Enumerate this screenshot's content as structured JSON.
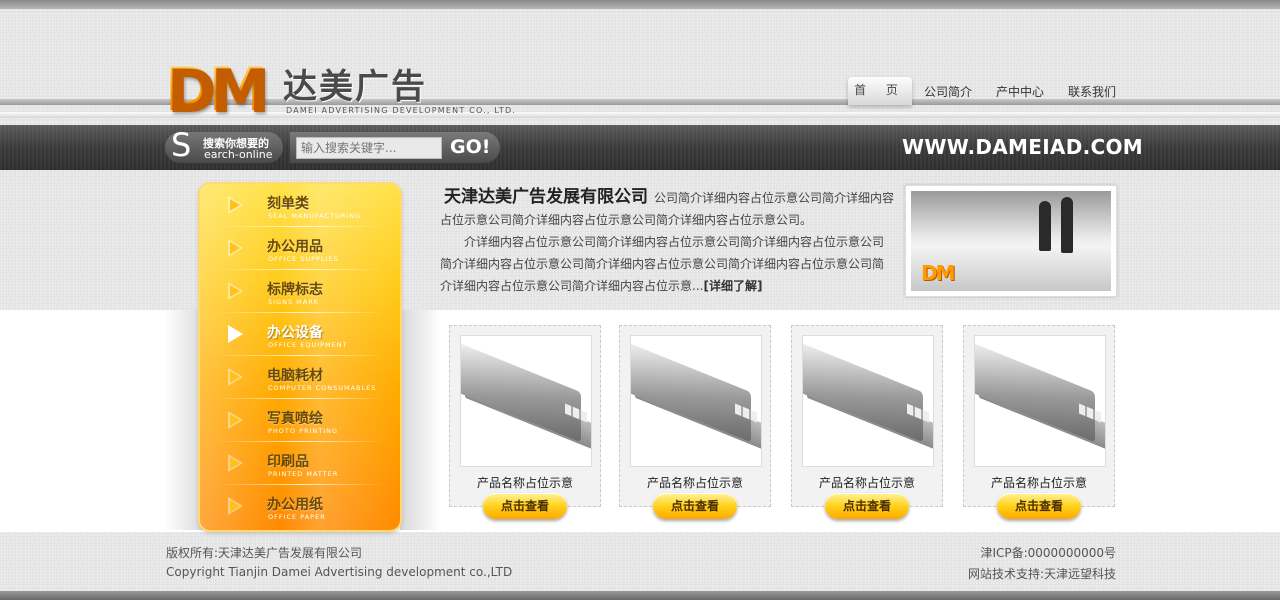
{
  "brand": {
    "logo_letters": "DM",
    "logo_cn": "达美广告",
    "logo_en": "DAMEI ADVERTISING DEVELOPMENT CO., LTD."
  },
  "nav": {
    "items": [
      {
        "label": "首 页"
      },
      {
        "label": "公司简介"
      },
      {
        "label": "产中中心"
      },
      {
        "label": "联系我们"
      }
    ]
  },
  "search": {
    "badge_letter": "S",
    "badge_line1": "搜索你想要的",
    "badge_line2": "earch-online",
    "placeholder": "输入搜索关键字...",
    "button_label": "GO!",
    "site_url": "WWW.DAMEIAD.COM"
  },
  "menu": {
    "items": [
      {
        "cn": "刻单类",
        "en": "SEAL MANUFACTURING"
      },
      {
        "cn": "办公用品",
        "en": "OFFICE SUPPLIES"
      },
      {
        "cn": "标牌标志",
        "en": "SIGNS MARK"
      },
      {
        "cn": "办公设备",
        "en": "OFFICE EQUIPMENT"
      },
      {
        "cn": "电脑耗材",
        "en": "COMPUTER CONSUMABLES"
      },
      {
        "cn": "写真喷绘",
        "en": "PHOTO PRINTING"
      },
      {
        "cn": "印刷品",
        "en": "PRINTED MATTER"
      },
      {
        "cn": "办公用纸",
        "en": "OFFICE PAPER"
      }
    ],
    "active_index": 3
  },
  "intro": {
    "title": "天津达美广告发展有限公司",
    "p1": "公司简介详细内容占位示意公司简介详细内容占位示意公司简介详细内容占位示意公司简介详细内容占位示意公司。",
    "p2": "介详细内容占位示意公司简介详细内容占位示意公司简介详细内容占位示意公司简介详细内容占位示意公司简介详细内容占位示意公司简介详细内容占位示意公司简介详细内容占位示意公司简介详细内容占位示意...",
    "more": "[详细了解]",
    "photo_logo": "DM"
  },
  "products": [
    {
      "name": "产品名称占位示意",
      "button": "点击查看"
    },
    {
      "name": "产品名称占位示意",
      "button": "点击查看"
    },
    {
      "name": "产品名称占位示意",
      "button": "点击查看"
    },
    {
      "name": "产品名称占位示意",
      "button": "点击查看"
    }
  ],
  "footer": {
    "copyright_cn": "版权所有:天津达美广告发展有限公司",
    "copyright_en": "Copyright Tianjin Damei Advertising development co.,LTD",
    "icp": "津ICP备:0000000000号",
    "support": "网站技术支持:天津远望科技"
  }
}
